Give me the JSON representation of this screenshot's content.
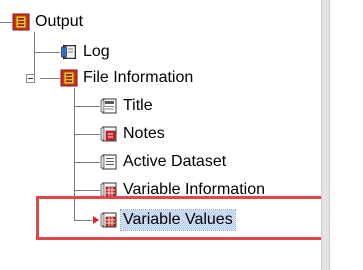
{
  "tree": {
    "root": {
      "label": "Output",
      "icon": "output-book-icon"
    },
    "items": [
      {
        "label": "Log",
        "icon": "log-book-icon"
      },
      {
        "label": "File Information",
        "icon": "output-book-icon",
        "expanded": true
      },
      {
        "label": "Title",
        "icon": "title-page-icon"
      },
      {
        "label": "Notes",
        "icon": "notes-page-icon"
      },
      {
        "label": "Active Dataset",
        "icon": "text-page-icon"
      },
      {
        "label": "Variable Information",
        "icon": "table-page-icon"
      },
      {
        "label": "Variable Values",
        "icon": "table-page-icon",
        "selected": true
      }
    ]
  },
  "colors": {
    "highlight_box": "#e04848",
    "selection": "#c7d9f3",
    "book_red": "#d62828",
    "book_yellow": "#f2c01b"
  }
}
